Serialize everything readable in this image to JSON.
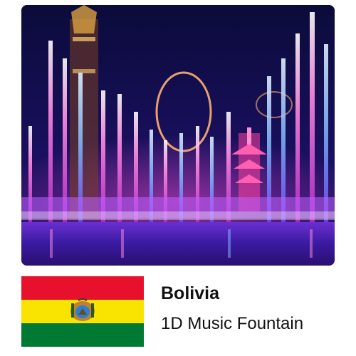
{
  "photo": {
    "subject": "music-fountain-night-show",
    "colors": {
      "sky": "#0a0a35",
      "jet_pink": "#ff5fd8",
      "jet_blue": "#7fb8ff",
      "pagoda": "#ff3fa0"
    }
  },
  "flag": {
    "country_icon": "bolivia-flag-icon",
    "colors": {
      "red": "#e8112d",
      "yellow": "#f9e300",
      "green": "#007a33"
    }
  },
  "caption": {
    "country": "Bolivia",
    "product": "1D Music Fountain"
  }
}
